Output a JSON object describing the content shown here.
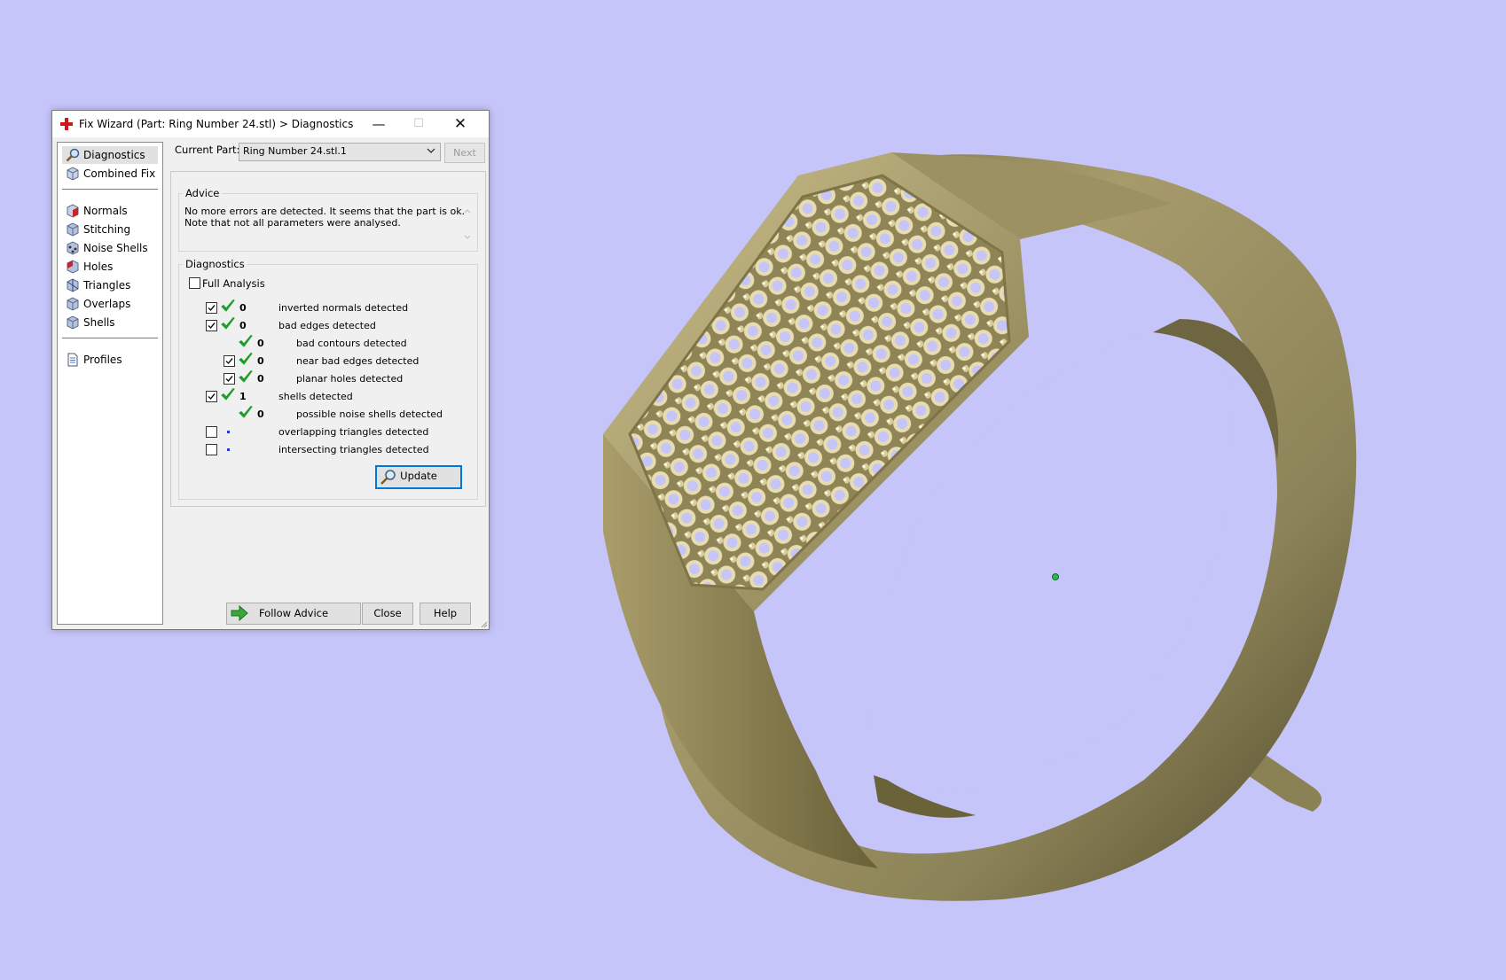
{
  "window": {
    "title": "Fix Wizard (Part: Ring Number 24.stl) > Diagnostics",
    "controls": {
      "minimize": "—",
      "maximize": "☐",
      "close": "✕"
    }
  },
  "sidebar": {
    "items": [
      {
        "label": "Diagnostics",
        "icon": "magnifier-icon",
        "selected": true
      },
      {
        "label": "Combined Fix",
        "icon": "cube-icon"
      },
      {
        "label": "Normals",
        "icon": "normals-cube-icon"
      },
      {
        "label": "Stitching",
        "icon": "stitching-cube-icon"
      },
      {
        "label": "Noise Shells",
        "icon": "noise-shells-cube-icon"
      },
      {
        "label": "Holes",
        "icon": "holes-cube-icon"
      },
      {
        "label": "Triangles",
        "icon": "triangles-cube-icon"
      },
      {
        "label": "Overlaps",
        "icon": "overlaps-cube-icon"
      },
      {
        "label": "Shells",
        "icon": "shells-cube-icon"
      },
      {
        "label": "Profiles",
        "icon": "document-icon"
      }
    ]
  },
  "current_part": {
    "label": "Current Part:",
    "value": "Ring Number 24.stl.1",
    "next_label": "Next"
  },
  "advice": {
    "title": "Advice",
    "lines": [
      "No more errors are detected. It seems that the part is ok.",
      "Note that not all parameters were analysed."
    ]
  },
  "diagnostics": {
    "title": "Diagnostics",
    "full_analysis_label": "Full Analysis",
    "full_analysis_checked": false,
    "rows": [
      {
        "checked": true,
        "status": "ok",
        "count": "0",
        "label": "inverted normals detected",
        "indent": 0
      },
      {
        "checked": true,
        "status": "ok",
        "count": "0",
        "label": "bad edges detected",
        "indent": 0
      },
      {
        "checkbox": false,
        "status": "ok",
        "count": "0",
        "label": "bad contours detected",
        "indent": 1
      },
      {
        "checked": true,
        "status": "ok",
        "count": "0",
        "label": "near bad edges detected",
        "indent": 1
      },
      {
        "checked": true,
        "status": "ok",
        "count": "0",
        "label": "planar holes detected",
        "indent": 1
      },
      {
        "checked": true,
        "status": "ok",
        "count": "1",
        "label": "shells detected",
        "indent": 0
      },
      {
        "checkbox": false,
        "status": "ok",
        "count": "0",
        "label": "possible noise shells detected",
        "indent": 1
      },
      {
        "checked": false,
        "status": "pending",
        "count": "",
        "label": "overlapping triangles detected",
        "indent": 0
      },
      {
        "checked": false,
        "status": "pending",
        "count": "",
        "label": "intersecting triangles detected",
        "indent": 0
      }
    ],
    "update_label": "Update"
  },
  "footer": {
    "follow_advice_label": "Follow Advice",
    "close_label": "Close",
    "help_label": "Help"
  },
  "colors": {
    "viewport_bg": "#c5c5fa",
    "ring_gold": "#a59a68",
    "check_green": "#1f9d2a",
    "focus_blue": "#0078d7"
  }
}
